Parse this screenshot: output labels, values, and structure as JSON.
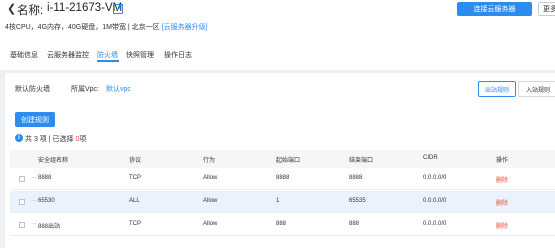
{
  "header": {
    "back_icon": "back-chevron-icon",
    "title_label": "名称:",
    "title_value": "i-11-21673-VM",
    "edit_icon": "edit-icon",
    "connect_button": "连接云服务器",
    "more_button": "更多",
    "specs_text": "4核CPU，4G内存，40G硬盘，1M带宽 | 北京一区 ",
    "specs_link": "[云服务器升级]"
  },
  "tabs": [
    "基础信息",
    "云服务器监控",
    "防火墙",
    "快照管理",
    "操作日志"
  ],
  "active_tab": "防火墙",
  "firewall": {
    "default_label": "默认防火墙",
    "vpc_label": "所属Vpc:",
    "vpc_value": "默认vpc",
    "out_rules": "出站规则",
    "in_rules": "入站规则",
    "create_button": "创建规则",
    "summary_prefix": "共 3 项 | 已选择 ",
    "summary_count": "0",
    "summary_suffix": "项"
  },
  "table": {
    "headers": [
      "安全组名称",
      "协议",
      "行为",
      "起始端口",
      "结束端口",
      "CIDR",
      "操作"
    ],
    "rows": [
      {
        "name": "8888",
        "protocol": "TCP",
        "action": "Allow",
        "start": "8888",
        "end": "8888",
        "cidr": "0.0.0.0/0",
        "op": "删除"
      },
      {
        "name": "65530",
        "protocol": "ALL",
        "action": "Allow",
        "start": "1",
        "end": "65535",
        "cidr": "0.0.0.0/0",
        "op": "删除"
      },
      {
        "name": "888出站",
        "protocol": "TCP",
        "action": "Allow",
        "start": "888",
        "end": "888",
        "cidr": "0.0.0.0/0",
        "op": "删除"
      }
    ]
  },
  "colors": {
    "accent": "#2d8cf0",
    "danger": "#e64a3c",
    "row_highlight": "#eaf3fd"
  }
}
